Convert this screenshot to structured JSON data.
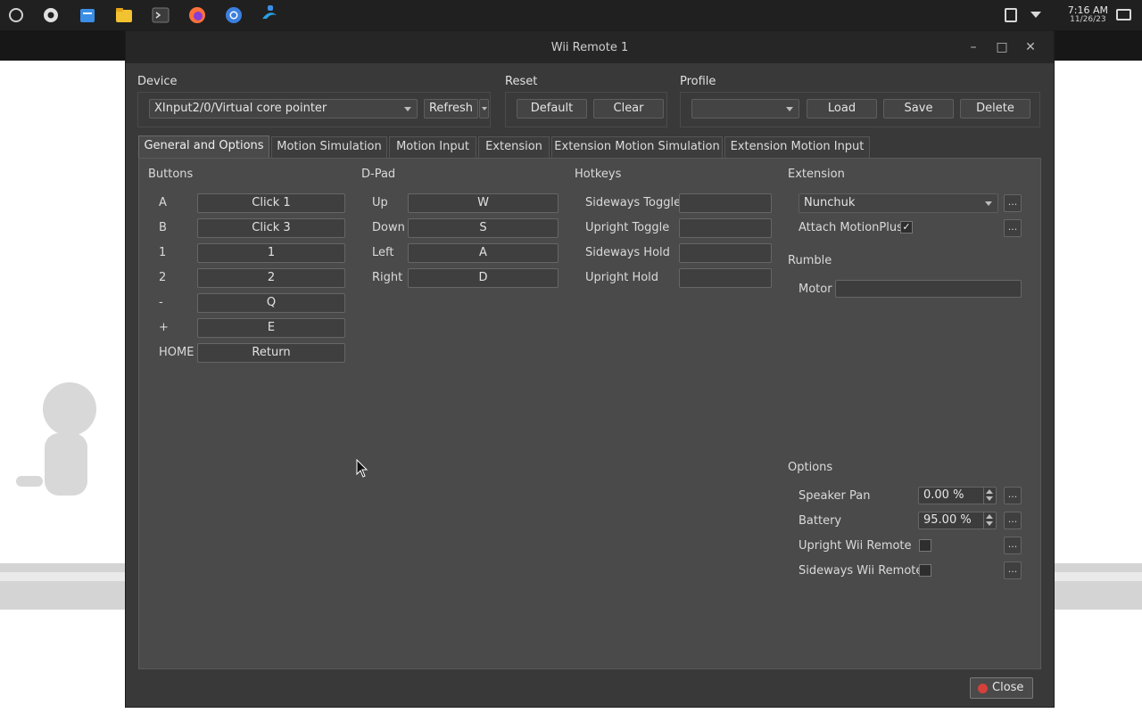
{
  "taskbar": {
    "icons": [
      "launcher-icon",
      "settings-icon",
      "store-icon",
      "files-icon",
      "terminal-icon",
      "firefox-icon",
      "chromium-icon",
      "dolphin-icon"
    ],
    "time": "7:16 AM",
    "date": "11/26/23"
  },
  "window": {
    "title": "Wii Remote 1"
  },
  "device": {
    "label": "Device",
    "selected": "XInput2/0/Virtual core pointer",
    "refresh_label": "Refresh"
  },
  "reset": {
    "label": "Reset",
    "default_label": "Default",
    "clear_label": "Clear"
  },
  "profile": {
    "label": "Profile",
    "selected": "",
    "load_label": "Load",
    "save_label": "Save",
    "delete_label": "Delete"
  },
  "tabs": [
    {
      "label": "General and Options",
      "active": true
    },
    {
      "label": "Motion Simulation",
      "active": false
    },
    {
      "label": "Motion Input",
      "active": false
    },
    {
      "label": "Extension",
      "active": false
    },
    {
      "label": "Extension Motion Simulation",
      "active": false
    },
    {
      "label": "Extension Motion Input",
      "active": false
    }
  ],
  "buttons": {
    "title": "Buttons",
    "rows": [
      {
        "name": "A",
        "value": "Click 1"
      },
      {
        "name": "B",
        "value": "Click 3"
      },
      {
        "name": "1",
        "value": "1"
      },
      {
        "name": "2",
        "value": "2"
      },
      {
        "name": "-",
        "value": "Q"
      },
      {
        "name": "+",
        "value": "E"
      },
      {
        "name": "HOME",
        "value": "Return"
      }
    ]
  },
  "dpad": {
    "title": "D-Pad",
    "rows": [
      {
        "name": "Up",
        "value": "W"
      },
      {
        "name": "Down",
        "value": "S"
      },
      {
        "name": "Left",
        "value": "A"
      },
      {
        "name": "Right",
        "value": "D"
      }
    ]
  },
  "hotkeys": {
    "title": "Hotkeys",
    "rows": [
      {
        "name": "Sideways Toggle",
        "value": ""
      },
      {
        "name": "Upright Toggle",
        "value": ""
      },
      {
        "name": "Sideways Hold",
        "value": ""
      },
      {
        "name": "Upright Hold",
        "value": ""
      }
    ]
  },
  "extension": {
    "title": "Extension",
    "selected": "Nunchuk",
    "attach_label": "Attach MotionPlus",
    "attach_checked": true,
    "more_label": "..."
  },
  "rumble": {
    "title": "Rumble",
    "motor_label": "Motor",
    "motor_value": ""
  },
  "options": {
    "title": "Options",
    "speaker_pan_label": "Speaker Pan",
    "speaker_pan_value": "0.00 %",
    "battery_label": "Battery",
    "battery_value": "95.00 %",
    "upright_label": "Upright Wii Remote",
    "upright_checked": false,
    "sideways_label": "Sideways Wii Remote",
    "sideways_checked": false
  },
  "footer": {
    "close_label": "Close"
  },
  "colors": {
    "accent_close": "#d4403a",
    "panel_bg": "#4a4a4a",
    "dialog_bg": "#393939"
  }
}
